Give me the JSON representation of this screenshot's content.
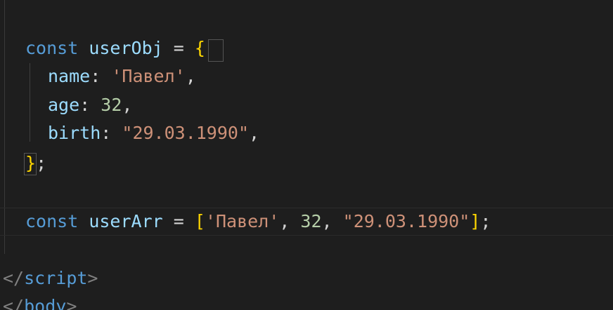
{
  "code": {
    "line_obj_decl": {
      "keyword": "const",
      "name": "userObj",
      "op": "=",
      "brace_open": "{"
    },
    "line_name": {
      "prop": "name",
      "colon": ":",
      "value": "'Павел'",
      "comma": ","
    },
    "line_age": {
      "prop": "age",
      "colon": ":",
      "value": "32",
      "comma": ","
    },
    "line_birth": {
      "prop": "birth",
      "colon": ":",
      "value": "\"29.03.1990\"",
      "comma": ","
    },
    "line_obj_close": {
      "brace_close": "}",
      "semicolon": ";"
    },
    "line_arr_decl": {
      "keyword": "const",
      "name": "userArr",
      "op": "=",
      "bracket_open": "[",
      "value1": "'Павел'",
      "comma1": ",",
      "value2": "32",
      "comma2": ",",
      "value3": "\"29.03.1990\"",
      "bracket_close": "]",
      "semicolon": ";"
    },
    "line_script_close": {
      "open": "</",
      "tag": "script",
      "close": ">"
    },
    "line_body_close": {
      "open": "</",
      "tag": "body",
      "close": ">"
    }
  },
  "colors": {
    "background": "#1e1e1e",
    "keyword": "#569cd6",
    "variable": "#9cdcfe",
    "string": "#ce9178",
    "number": "#b5cea8",
    "brace": "#ffd700"
  }
}
